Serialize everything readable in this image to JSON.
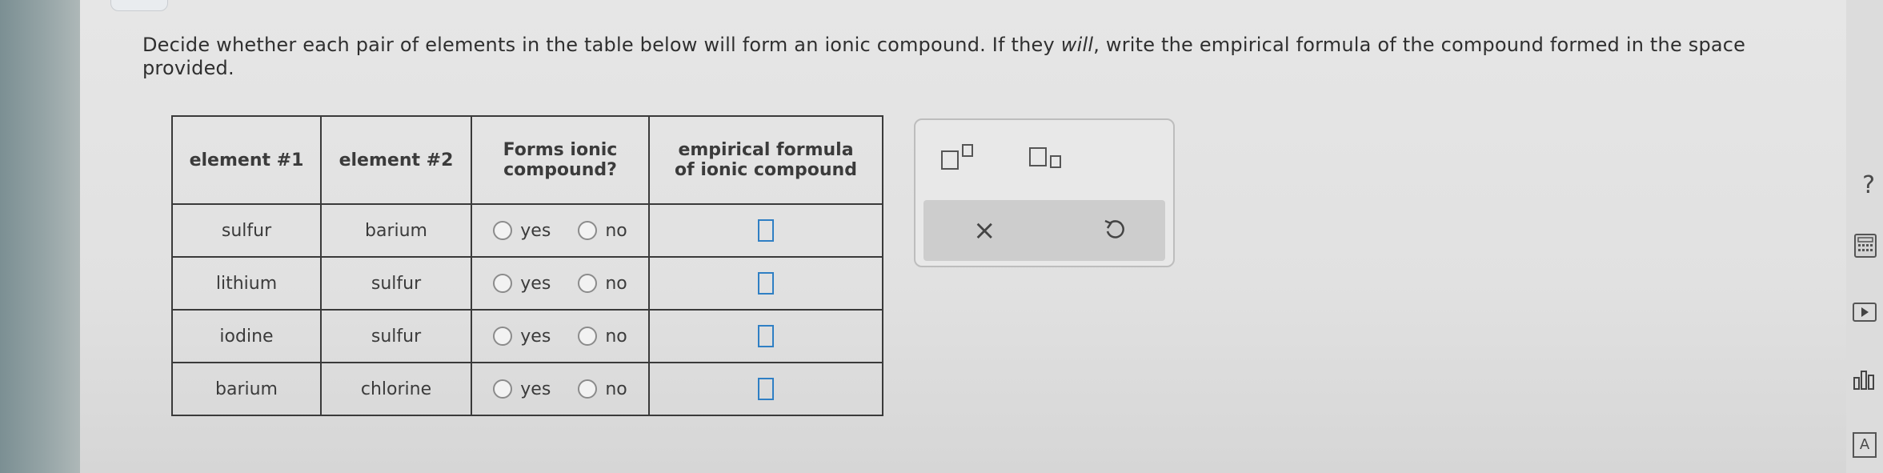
{
  "instructions": {
    "part1": "Decide whether each pair of elements in the table below will form an ionic compound. If they ",
    "emphasis": "will",
    "part2": ", write the empirical formula of the compound formed in the space provided."
  },
  "table": {
    "headers": [
      "element #1",
      "element #2",
      "Forms ionic compound?",
      "empirical formula of ionic compound"
    ],
    "rows": [
      {
        "element1": "sulfur",
        "element2": "barium",
        "yes_label": "yes",
        "no_label": "no"
      },
      {
        "element1": "lithium",
        "element2": "sulfur",
        "yes_label": "yes",
        "no_label": "no"
      },
      {
        "element1": "iodine",
        "element2": "sulfur",
        "yes_label": "yes",
        "no_label": "no"
      },
      {
        "element1": "barium",
        "element2": "chlorine",
        "yes_label": "yes",
        "no_label": "no"
      }
    ]
  },
  "toolbar": {
    "clear_symbol": "×"
  },
  "sidebar": {
    "help_symbol": "?",
    "text_icon_label": "A"
  },
  "colors": {
    "answer_box_border": "#2f7fc4",
    "table_border": "#3a3a3a"
  }
}
